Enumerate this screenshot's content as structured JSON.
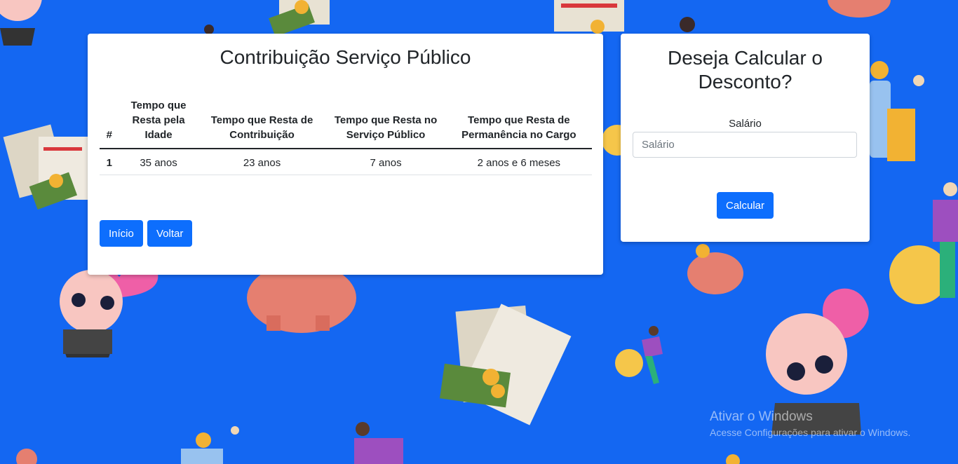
{
  "main_card": {
    "title": "Contribuição Serviço Público",
    "table": {
      "headers": [
        "#",
        "Tempo que Resta pela Idade",
        "Tempo que Resta de Contribuição",
        "Tempo que Resta no Serviço Público",
        "Tempo que Resta de Permanência no Cargo"
      ],
      "rows": [
        [
          "1",
          "35 anos",
          "23 anos",
          "7 anos",
          "2 anos e 6 meses"
        ]
      ]
    },
    "buttons": {
      "inicio": "Início",
      "voltar": "Voltar"
    }
  },
  "side_card": {
    "title": "Deseja Calcular o Desconto?",
    "salario_label": "Salário",
    "salario_placeholder": "Salário",
    "salario_value": "",
    "calcular_label": "Calcular"
  },
  "watermark": {
    "line1": "Ativar o Windows",
    "line2": "Acesse Configurações para ativar o Windows."
  },
  "colors": {
    "background": "#1467f2",
    "primary_button": "#0d6efd",
    "card": "#ffffff"
  }
}
